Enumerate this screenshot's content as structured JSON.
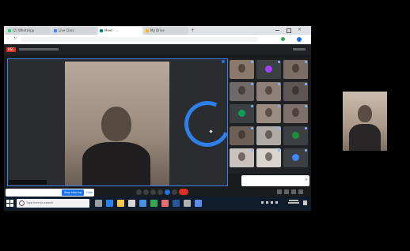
{
  "browser": {
    "tabs": [
      {
        "label": "(2) WhatsApp",
        "fav": "#25d366",
        "active": false
      },
      {
        "label": "Live Class",
        "fav": "#4285f4",
        "active": false
      },
      {
        "label": "Meet - ...",
        "fav": "#00897b",
        "active": true
      },
      {
        "label": "My Drive",
        "fav": "#fbbc04",
        "active": false
      }
    ]
  },
  "meet": {
    "rec_label": "REC"
  },
  "toast": {
    "text": "",
    "action_label": "",
    "close_glyph": "×"
  },
  "share_banner": {
    "text": "",
    "stop_label": "Stop sharing",
    "hide_label": "Hide"
  },
  "taskbar": {
    "search_placeholder": "Type here to search"
  },
  "self_view": {
    "name": ""
  },
  "participants": [
    {
      "kind": "video",
      "color": "#8b7a6b"
    },
    {
      "kind": "avatar",
      "color": "#3c4043",
      "avatar": "#a142f4"
    },
    {
      "kind": "video",
      "color": "#7a6e66"
    },
    {
      "kind": "video",
      "color": "#6f6a68"
    },
    {
      "kind": "video",
      "color": "#8d8079"
    },
    {
      "kind": "video",
      "color": "#5b5654"
    },
    {
      "kind": "avatar",
      "color": "#3c4043",
      "avatar": "#0f9d58"
    },
    {
      "kind": "video",
      "color": "#9a8c80"
    },
    {
      "kind": "video",
      "color": "#7d706a"
    },
    {
      "kind": "video",
      "color": "#6d5f55"
    },
    {
      "kind": "video",
      "color": "#b0aaa6"
    },
    {
      "kind": "avatar",
      "color": "#3c4043",
      "avatar": "#1e8e3e"
    },
    {
      "kind": "video",
      "color": "#c9c2bd"
    },
    {
      "kind": "video",
      "color": "#dad4cf"
    },
    {
      "kind": "avatar",
      "color": "#3c4043",
      "avatar": "#4285f4"
    }
  ],
  "taskbar_icons": [
    {
      "name": "task-view-icon",
      "color": "#9aa0a6"
    },
    {
      "name": "edge-icon",
      "color": "#2f7fe8"
    },
    {
      "name": "file-explorer-icon",
      "color": "#f2c94c"
    },
    {
      "name": "store-icon",
      "color": "#d6d6d6"
    },
    {
      "name": "mail-icon",
      "color": "#4a90e2"
    },
    {
      "name": "chrome-icon",
      "color": "#34a853"
    },
    {
      "name": "photos-icon",
      "color": "#e66f6f"
    },
    {
      "name": "word-icon",
      "color": "#2b579a"
    },
    {
      "name": "settings-icon",
      "color": "#b0b0b0"
    },
    {
      "name": "app-icon",
      "color": "#5b8def"
    }
  ],
  "colors": {
    "accent": "#1a73e8",
    "end_call": "#d93025",
    "spinner": "#2f7fe8"
  }
}
